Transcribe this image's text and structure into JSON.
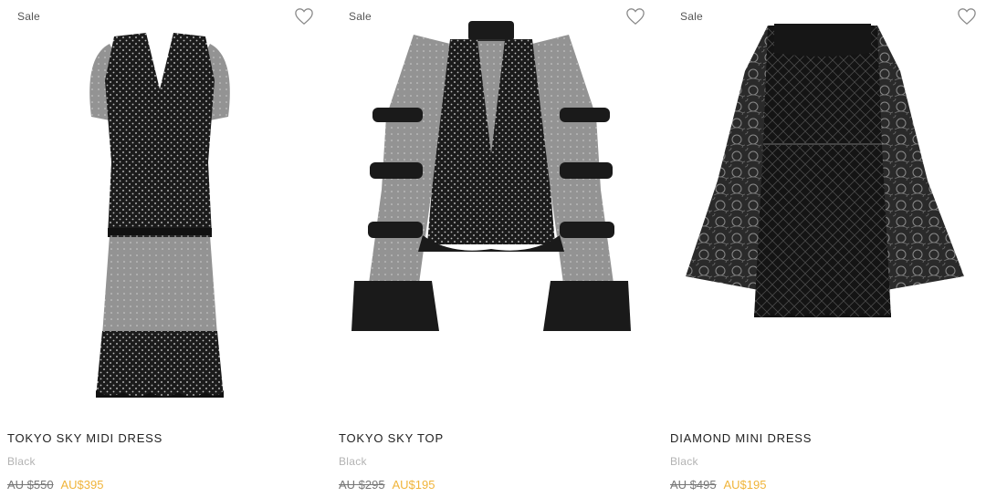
{
  "products": [
    {
      "badge": "Sale",
      "name": "TOKYO SKY MIDI DRESS",
      "color": "Black",
      "old_price": "AU $550",
      "new_price": "AU$395",
      "wishlist_icon": "heart-outline-icon"
    },
    {
      "badge": "Sale",
      "name": "TOKYO SKY TOP",
      "color": "Black",
      "old_price": "AU $295",
      "new_price": "AU$195",
      "wishlist_icon": "heart-outline-icon"
    },
    {
      "badge": "Sale",
      "name": "DIAMOND MINI DRESS",
      "color": "Black",
      "old_price": "AU $495",
      "new_price": "AU$195",
      "wishlist_icon": "heart-outline-icon"
    }
  ],
  "colors": {
    "sale_price": "#f0b43a",
    "old_price": "#777777",
    "color_label": "#b3b3b3"
  }
}
